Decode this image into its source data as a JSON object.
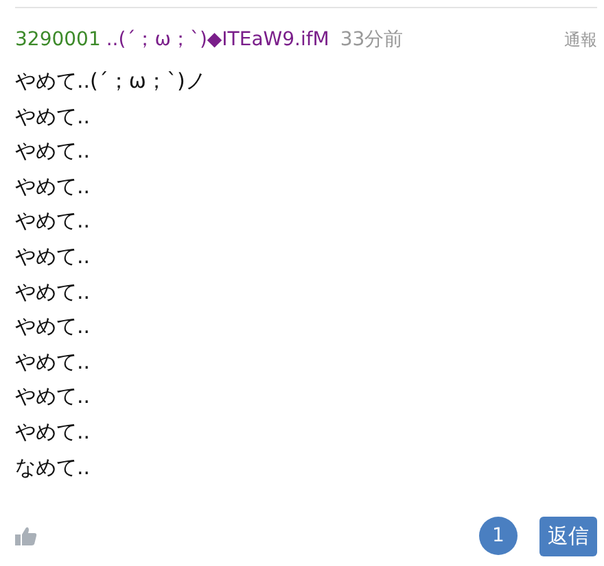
{
  "post": {
    "number": "3290001",
    "name": "..(´；ω；`)◆ITEaW9.ifM",
    "time": "33分前",
    "report": "通報",
    "lines": [
      "やめて..(´；ω；`)ノ",
      "やめて..",
      "やめて..",
      "やめて..",
      "やめて..",
      "やめて..",
      "やめて..",
      "やめて..",
      "やめて..",
      "やめて..",
      "やめて..",
      "なめて.."
    ],
    "reply_count": "1",
    "reply_button": "返信"
  }
}
